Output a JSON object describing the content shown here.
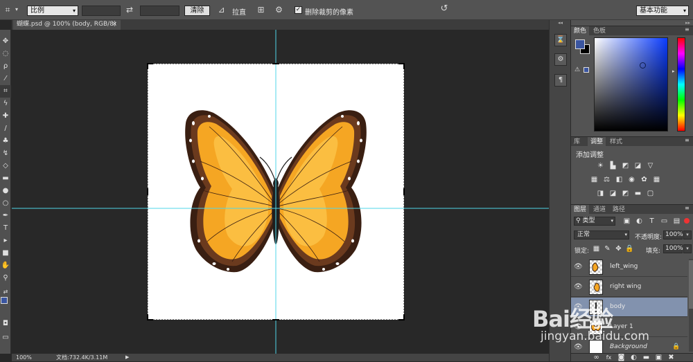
{
  "options_bar": {
    "ratio_select": "比例",
    "clear_button": "清除",
    "straighten_label": "拉直",
    "delete_cropped_label": "删除裁剪的像素",
    "delete_cropped_checked": true,
    "workspace_select": "基本功能"
  },
  "document_tab": {
    "title": "蝴蝶.psd @ 100% (body, RGB/8)",
    "close": "×"
  },
  "status_bar": {
    "zoom": "100%",
    "doc_info": "文档:732.4K/3.11M"
  },
  "color_panel": {
    "tabs": [
      "颜色",
      "色板"
    ],
    "foreground": "#3a55a0",
    "background": "#000000",
    "cursor_color": "#0f1d4a"
  },
  "adjustments_panel": {
    "tabs": [
      "库",
      "调整",
      "样式"
    ],
    "title": "添加调整"
  },
  "layers_panel": {
    "tabs": [
      "图层",
      "通道",
      "路径"
    ],
    "filter_kind": "类型",
    "blend_mode": "正常",
    "opacity_label": "不透明度:",
    "opacity_value": "100%",
    "lock_label": "锁定:",
    "fill_label": "填充:",
    "fill_value": "100%",
    "layers": [
      {
        "name": "left_wing",
        "selected": false
      },
      {
        "name": "right wing",
        "selected": false
      },
      {
        "name": "body",
        "selected": true
      },
      {
        "name": "Layer 1",
        "selected": false
      },
      {
        "name": "Background",
        "selected": false,
        "locked": true
      }
    ],
    "footer_icons": [
      "link-icon",
      "fx-icon",
      "mask-icon",
      "adjustment-icon",
      "folder-icon",
      "new-layer-icon",
      "trash-icon"
    ]
  },
  "watermark": {
    "brand": "Bai经验",
    "url": "jingyan.baidu.com"
  }
}
